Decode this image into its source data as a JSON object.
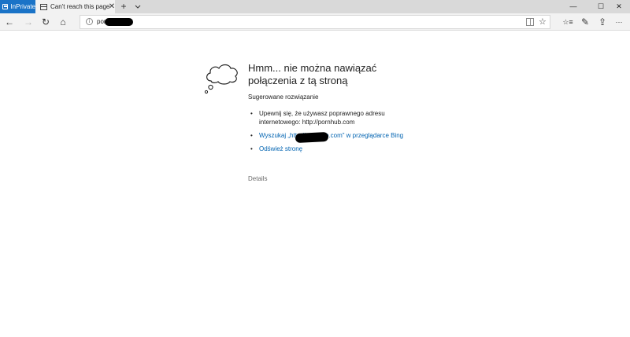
{
  "window": {
    "inprivate_label": "InPrivate",
    "minimize_glyph": "—",
    "maximize_glyph": "☐",
    "close_glyph": "✕"
  },
  "tab": {
    "title": "Can't reach this page",
    "close_glyph": "✕",
    "add_glyph": "+",
    "list_glyph": "⌄"
  },
  "nav": {
    "back_glyph": "←",
    "forward_glyph": "→",
    "refresh_glyph": "↻",
    "home_glyph": "⌂",
    "address_value": "porn",
    "address_info_glyph": "i",
    "favorite_glyph": "☆",
    "favorites_hub_glyph": "☆≡",
    "notes_glyph": "✎",
    "share_glyph": "⇪",
    "more_glyph": "···"
  },
  "error": {
    "title": "Hmm... nie można nawiązać połączenia z tą stroną",
    "subtitle": "Sugerowane rozwiązanie",
    "suggestions": {
      "check_address": "Upewnij się, że używasz poprawnego adresu internetowego: http://pornhub.com",
      "search_bing": "Wyszukaj „http://pornhub.com” w przeglądarce Bing",
      "refresh": "Odśwież stronę"
    },
    "details": "Details"
  },
  "colors": {
    "inprivate_bg": "#1a73c7",
    "link": "#0063b1",
    "tabbar_bg": "#d9d9d9",
    "toolbar_bg": "#f2f2f2"
  },
  "icons": [
    "inprivate-icon",
    "page-icon",
    "info-icon",
    "reading-view-icon",
    "star-icon",
    "favorites-hub-icon",
    "notes-icon",
    "share-icon",
    "more-icon",
    "cloud-icon"
  ]
}
